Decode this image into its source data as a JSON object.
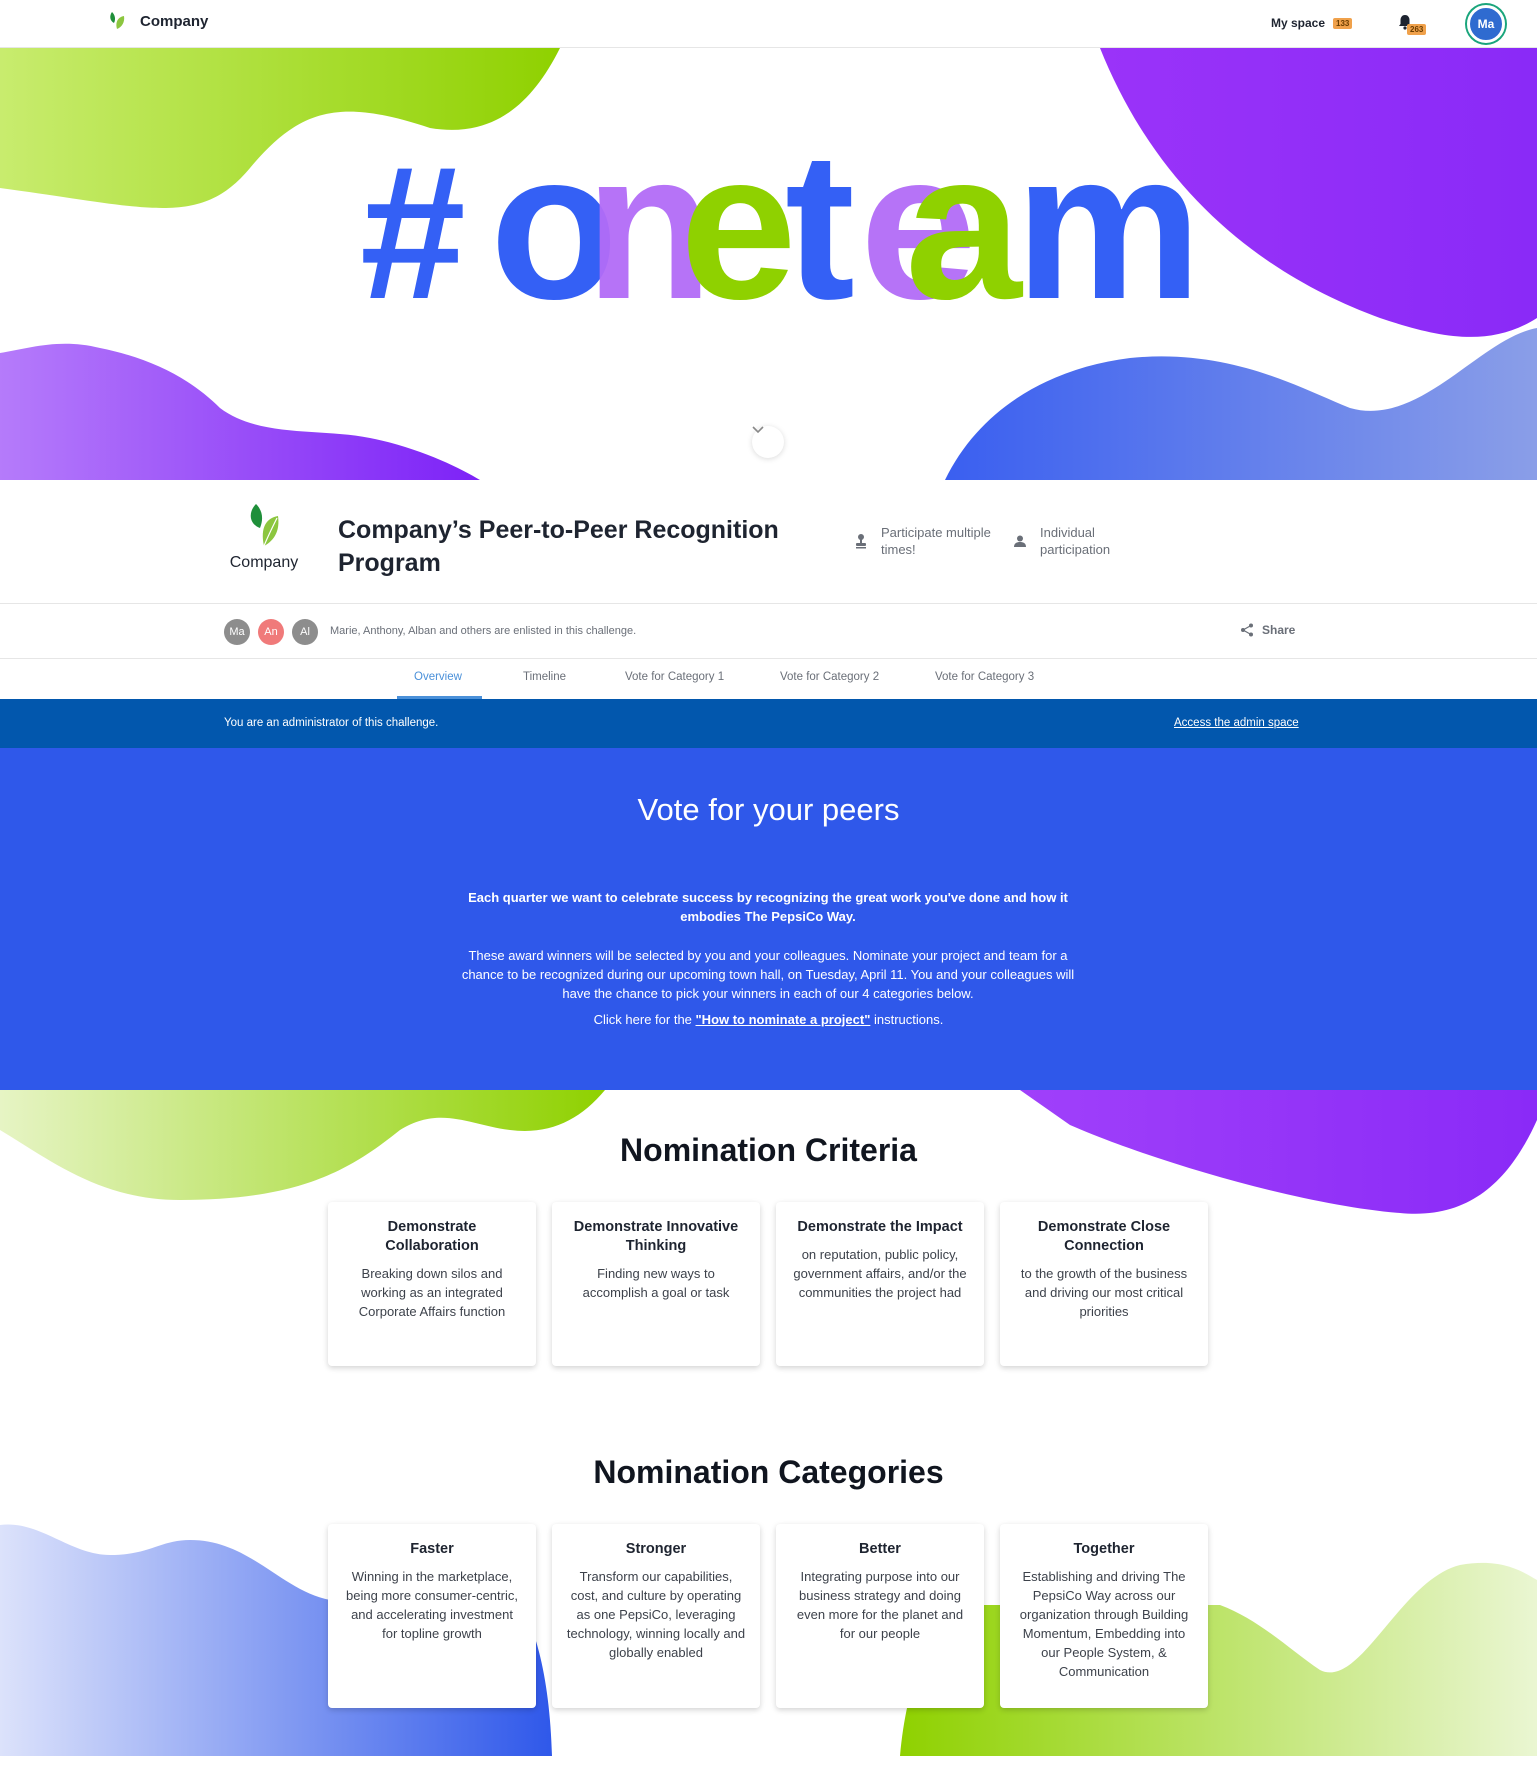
{
  "topnav": {
    "brand_name": "Company",
    "my_space_label": "My space",
    "my_space_count": "133",
    "notifications_count": "263",
    "user_initials": "Ma"
  },
  "hero": {
    "headline": "#oneteam",
    "colors": {
      "blue": "#3460f5",
      "purple": "#b26bf7",
      "green": "#8fd100",
      "dark_blue": "#001f8a",
      "violet": "#7b2bf5"
    }
  },
  "challenge": {
    "logo_text": "Company",
    "title": "Company’s Peer-to-Peer Recognition Program",
    "features": [
      {
        "icon": "stamp-icon",
        "label": "Participate multiple times!"
      },
      {
        "icon": "person-icon",
        "label": "Individual participation"
      }
    ]
  },
  "participants": {
    "avatars": [
      {
        "initials": "Ma",
        "color": "#8d8d8d"
      },
      {
        "initials": "An",
        "color": "#f07a7a"
      },
      {
        "initials": "Al",
        "color": "#8d8d8d"
      }
    ],
    "text": "Marie, Anthony, Alban and others are enlisted in this challenge.",
    "share_label": "Share"
  },
  "tabs": [
    {
      "label": "Overview",
      "active": true
    },
    {
      "label": "Timeline",
      "active": false
    },
    {
      "label": "Vote for Category 1",
      "active": false
    },
    {
      "label": "Vote for Category 2",
      "active": false
    },
    {
      "label": "Vote for Category 3",
      "active": false
    }
  ],
  "admin_bar": {
    "text": "You are an administrator of this challenge.",
    "link": "Access the admin space"
  },
  "vote_banner": {
    "title": "Vote for your peers",
    "lead": "Each quarter we want to celebrate success by recognizing the great work you've done and how it embodies The PepsiCo Way.",
    "body": "These award winners will be selected by you and your colleagues. Nominate your project and team for a chance to be recognized during our upcoming town hall, on Tuesday, April 11. You and your colleagues will have the chance to pick your winners in each of our 4 categories below.",
    "cta_prefix": "Click here for the ",
    "cta_link": "\"How to nominate a project\"",
    "cta_suffix": " instructions."
  },
  "criteria": {
    "title": "Nomination Criteria",
    "cards": [
      {
        "title": "Demonstrate Collaboration",
        "desc": "Breaking down silos and working as an integrated Corporate Affairs function"
      },
      {
        "title": "Demonstrate Innovative Thinking",
        "desc": "Finding new ways to accomplish a goal or task"
      },
      {
        "title": "Demonstrate the Impact",
        "desc": "on reputation, public policy, government affairs, and/or the communities the project had"
      },
      {
        "title": "Demonstrate Close Connection",
        "desc": "to the growth of the business and driving our most critical priorities"
      }
    ]
  },
  "categories": {
    "title": "Nomination Categories",
    "cards": [
      {
        "title": "Faster",
        "desc": "Winning in the marketplace, being more consumer-centric, and accelerating investment for topline growth"
      },
      {
        "title": "Stronger",
        "desc": "Transform our capabilities, cost, and culture by operating as one PepsiCo, leveraging technology, winning locally and globally enabled"
      },
      {
        "title": "Better",
        "desc": "Integrating purpose into our business strategy and doing even more for the planet and for our people"
      },
      {
        "title": "Together",
        "desc": "Establishing and driving The PepsiCo Way across our organization through Building Momentum, Embedding into our People System, & Communication"
      }
    ]
  }
}
